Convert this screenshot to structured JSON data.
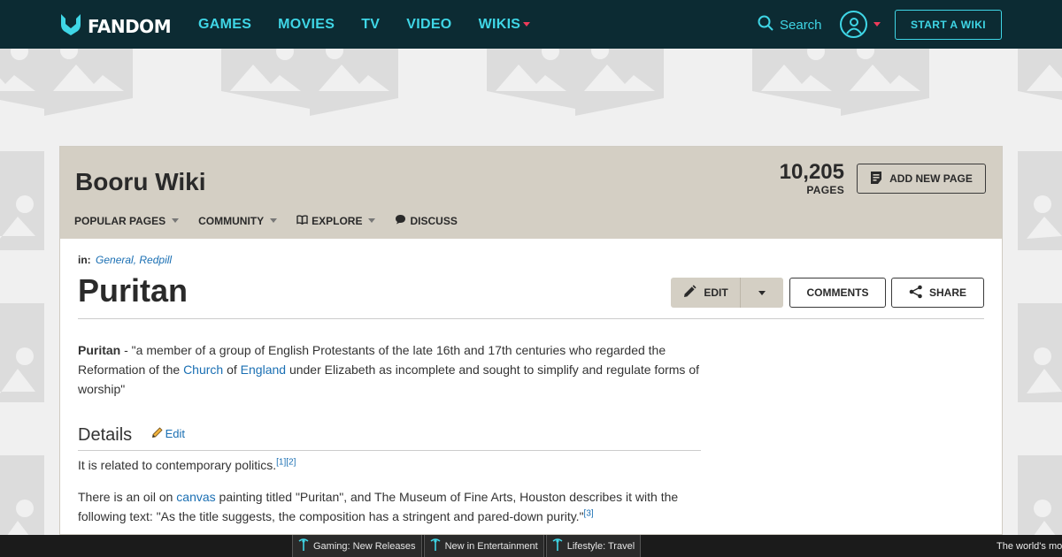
{
  "topnav": {
    "logo_text": "FANDOM",
    "links": [
      {
        "label": "GAMES"
      },
      {
        "label": "MOVIES"
      },
      {
        "label": "TV"
      },
      {
        "label": "VIDEO"
      },
      {
        "label": "WIKIS"
      }
    ],
    "search_label": "Search",
    "start_wiki_label": "START A WIKI"
  },
  "wiki": {
    "title": "Booru Wiki",
    "pages_count": "10,205",
    "pages_label": "PAGES",
    "add_page_label": "ADD NEW PAGE",
    "nav": [
      {
        "label": "POPULAR PAGES"
      },
      {
        "label": "COMMUNITY"
      },
      {
        "label": "EXPLORE"
      },
      {
        "label": "DISCUSS"
      }
    ]
  },
  "article": {
    "in_label": "in:",
    "categories": "General, Redpill",
    "title": "Puritan",
    "edit_label": "EDIT",
    "comments_label": "COMMENTS",
    "share_label": "SHARE",
    "intro_bold": "Puritan",
    "intro_1": " - \"a member of a group of English Protestants of the late 16th and 17th centuries who regarded the Reformation of the ",
    "intro_link_church": "Church",
    "intro_of": " of ",
    "intro_link_england": "England",
    "intro_2": " under Elizabeth as incomplete and sought to simplify and regulate forms of worship\"",
    "section_title": "Details",
    "section_edit": "Edit",
    "p2_text": "It is related to contemporary politics.",
    "p2_refs": "[1][2]",
    "p3_1": "There is an oil on ",
    "p3_link": "canvas",
    "p3_2": " painting titled \"Puritan\", and The Museum of Fine Arts, Houston describes it with the following text: \"As the title suggests, the composition has a stringent and pared-down purity.\"",
    "p3_ref": "[3]"
  },
  "bottombar": {
    "items": [
      {
        "label": "Gaming: New Releases"
      },
      {
        "label": "New in Entertainment"
      },
      {
        "label": "Lifestyle: Travel"
      }
    ],
    "right_text": "The world's most"
  },
  "colors": {
    "nav_bg": "#0c2b33",
    "accent": "#3fd6e6",
    "caret": "#ef3b5a",
    "header_bg": "#d4cfc4",
    "link": "#1a6fb3"
  }
}
